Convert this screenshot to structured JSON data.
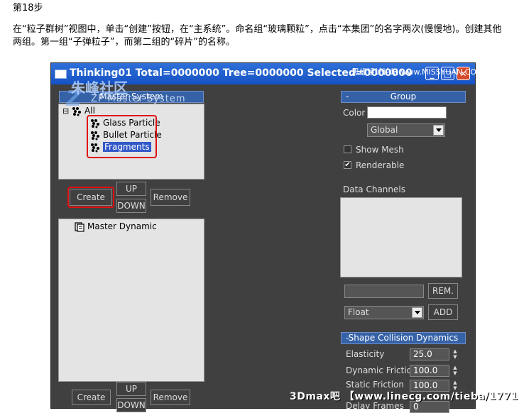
{
  "doc": {
    "step": "第18步",
    "instructions": "在“粒子群树”视图中，单击“创建”按钮，在“主系统”。命名组“玻璃颗粒”，点击“本集团”的名字两次(慢慢地)。创建其他两组。第一组“子弹粒子”，而第二组的“碎片”的名称。"
  },
  "window": {
    "title": "Thinking01  Total=0000000  Tree=0000000  Selected=0000000",
    "minimize": "_",
    "maximize": "□",
    "close": "✕"
  },
  "watermark": {
    "zhufeng": "朱峰社区",
    "zf_logo": "Z",
    "zf_text": "ZF Master System",
    "missyuan": "思缘设计论坛 www.MISSYUAN.COM",
    "bottom": "3Dmax吧 【www.linecg.com/tieba/1771】"
  },
  "left": {
    "master_header": "Master System",
    "tree": {
      "collapse": "⊟",
      "root": "All",
      "children": [
        "Glass Particle",
        "Bullet Particle",
        "Fragments"
      ]
    },
    "buttons_top": {
      "create": "Create",
      "up": "UP",
      "down": "DOWN",
      "remove": "Remove"
    },
    "dynamic_root": "Master Dynamic",
    "buttons_bottom": {
      "create": "Create",
      "up": "UP",
      "down": "DOWN",
      "remove": "Remove"
    }
  },
  "right": {
    "group_header": {
      "toggle": "-",
      "title": "Group"
    },
    "color_label": "Color",
    "color_value": "#ffffff",
    "global_select": "Global",
    "show_mesh": {
      "label": "Show Mesh",
      "checked": false
    },
    "renderable": {
      "label": "Renderable",
      "checked": true,
      "mark": "✔"
    },
    "data_channels_label": "Data Channels",
    "rem_button": "REM.",
    "type_select": "Float",
    "add_button": "ADD",
    "collision_header": {
      "toggle": "-",
      "title": "Shape Collision Dynamics"
    },
    "params": [
      {
        "label": "Elasticity",
        "value": "25.0"
      },
      {
        "label": "Dynamic Friction",
        "value": "100.0"
      },
      {
        "label": "Static Friction",
        "value": "100.0"
      },
      {
        "label": "Delay Frames",
        "value": "0"
      }
    ]
  },
  "colors": {
    "highlight": "#3158c8",
    "annotation": "#e01010"
  }
}
